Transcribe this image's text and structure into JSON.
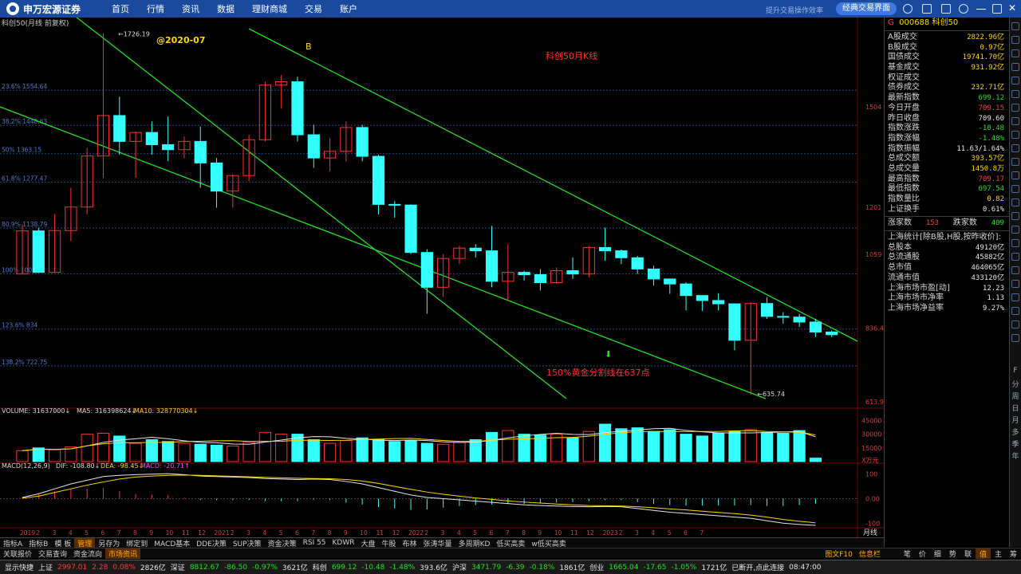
{
  "app": {
    "brand": "申万宏源证券",
    "slogan": "提升交易操作效率"
  },
  "nav": [
    "首页",
    "行情",
    "资讯",
    "数据",
    "理财商城",
    "交易",
    "账户"
  ],
  "classic_button": "经典交易界面",
  "chart": {
    "header": "科创50(月线 前复权)",
    "watermark_date": "@2020-07",
    "label_b": "B",
    "title_note": "科创50月K线",
    "fib_note": "150%黄金分割线在637点",
    "high_label": "1726.19",
    "low_label": "635.74",
    "fib_levels": [
      "23.6% 1554.64",
      "38.2% 1448.63",
      "50% 1363.15",
      "61.8% 1277.47",
      "80.9% 1138.79",
      "100% 1000.11",
      "123.6% 834",
      "138.2% 722.75"
    ],
    "price_axis": [
      "1504",
      "1201",
      "1059",
      "836.4",
      "613.9"
    ],
    "volume_header": {
      "volume": "VOLUME: 31637000↓",
      "ma5": "MA5: 316398624↓",
      "ma10": "MA10: 328770304↓"
    },
    "volume_axis": [
      "45000",
      "30000",
      "15000",
      "X万元"
    ],
    "macd_header": {
      "name": "MACD(12,26,9)",
      "dif": "DIF: -108.80↓",
      "dea": "DEA: -98.45↓",
      "macd": "MACD: -20.71↑"
    },
    "macd_axis": [
      "100",
      "0.00",
      "-100"
    ],
    "date_axis": [
      "2019",
      "2",
      "3",
      "4",
      "5",
      "6",
      "7",
      "8",
      "9",
      "10",
      "11",
      "12",
      "2021",
      "2",
      "3",
      "4",
      "5",
      "6",
      "7",
      "8",
      "9",
      "10",
      "11",
      "12",
      "2022",
      "2",
      "3",
      "4",
      "5",
      "6",
      "7",
      "8",
      "9",
      "10",
      "11",
      "12",
      "2023",
      "2",
      "3",
      "4",
      "5",
      "6",
      "7"
    ],
    "period": "月线"
  },
  "chart_data": {
    "type": "candlestick",
    "candles": [
      [
        1000,
        1130,
        1000,
        1150
      ],
      [
        1130,
        1005,
        1003,
        1140
      ],
      [
        1005,
        1131,
        1005,
        1180
      ],
      [
        1131,
        1202,
        1100,
        1260
      ],
      [
        1202,
        1356,
        1180,
        1380
      ],
      [
        1356,
        1478,
        1290,
        1726.19
      ],
      [
        1478,
        1400,
        1360,
        1535
      ],
      [
        1400,
        1427,
        1290,
        1430
      ],
      [
        1427,
        1390,
        1360,
        1460
      ],
      [
        1390,
        1375,
        1340,
        1475
      ],
      [
        1375,
        1400,
        1350,
        1415
      ],
      [
        1400,
        1335,
        1260,
        1445
      ],
      [
        1335,
        1250,
        1200,
        1350
      ],
      [
        1250,
        1297,
        1200,
        1300
      ],
      [
        1297,
        1405,
        1280,
        1420
      ],
      [
        1405,
        1570,
        1400,
        1580
      ],
      [
        1570,
        1580,
        1500,
        1600
      ],
      [
        1580,
        1420,
        1400,
        1595
      ],
      [
        1420,
        1350,
        1320,
        1450
      ],
      [
        1350,
        1370,
        1310,
        1410
      ],
      [
        1370,
        1442,
        1340,
        1460
      ],
      [
        1442,
        1355,
        1340,
        1450
      ],
      [
        1355,
        1210,
        1180,
        1360
      ],
      [
        1210,
        1208,
        1170,
        1220
      ],
      [
        1208,
        1065,
        1060,
        1210
      ],
      [
        1065,
        960,
        880,
        1075
      ],
      [
        960,
        1047,
        930,
        1060
      ],
      [
        1047,
        1078,
        1030,
        1085
      ],
      [
        1078,
        1070,
        1050,
        1090
      ],
      [
        1070,
        978,
        960,
        1145
      ],
      [
        978,
        1005,
        920,
        1090
      ],
      [
        1005,
        998,
        980,
        1010
      ],
      [
        998,
        974,
        950,
        1015
      ],
      [
        974,
        1010,
        970,
        1020
      ],
      [
        1010,
        1000,
        985,
        1050
      ],
      [
        1000,
        1080,
        990,
        1085
      ],
      [
        1080,
        1070,
        1040,
        1140
      ],
      [
        1070,
        1049,
        1030,
        1074
      ],
      [
        1049,
        1015,
        1000,
        1055
      ],
      [
        1015,
        985,
        965,
        1025
      ],
      [
        985,
        970,
        940,
        985
      ],
      [
        970,
        935,
        890,
        975
      ],
      [
        935,
        920,
        888,
        935
      ],
      [
        920,
        910,
        890,
        942
      ],
      [
        910,
        800,
        770,
        910
      ],
      [
        800,
        911,
        635.74,
        915
      ],
      [
        911,
        872,
        865,
        930
      ],
      [
        872,
        870,
        850,
        885
      ],
      [
        870,
        855,
        840,
        880
      ],
      [
        855,
        825,
        810,
        865
      ],
      [
        825,
        817,
        810,
        830
      ]
    ],
    "volume": [
      12000,
      15000,
      13000,
      16000,
      30000,
      31000,
      28000,
      20000,
      24000,
      22000,
      20000,
      19000,
      18000,
      17000,
      21000,
      32000,
      30000,
      30000,
      24000,
      20000,
      23000,
      26000,
      24000,
      22000,
      23000,
      20000,
      19000,
      21000,
      24000,
      32000,
      34000,
      30000,
      29000,
      30000,
      26000,
      33000,
      41000,
      36000,
      37000,
      33000,
      35000,
      30000,
      28000,
      31000,
      33000,
      35000,
      32000,
      31000,
      34000,
      3800
    ],
    "dif": [
      5,
      20,
      40,
      60,
      75,
      90,
      95,
      98,
      100,
      102,
      98,
      92,
      90,
      88,
      86,
      82,
      80,
      78,
      80,
      78,
      70,
      60,
      45,
      30,
      15,
      5,
      0,
      -5,
      -10,
      -15,
      -20,
      -25,
      -28,
      -30,
      -32,
      -33,
      -32,
      -33,
      -40,
      -48,
      -55,
      -60,
      -65,
      -70,
      -75,
      -80,
      -90,
      -100,
      -105,
      -108.8
    ],
    "dea": [
      2,
      10,
      25,
      40,
      55,
      68,
      80,
      88,
      92,
      95,
      96,
      95,
      93,
      91,
      89,
      87,
      85,
      83,
      82,
      81,
      78,
      72,
      62,
      50,
      38,
      27,
      18,
      10,
      3,
      -3,
      -9,
      -14,
      -18,
      -22,
      -25,
      -28,
      -29,
      -30,
      -33,
      -37,
      -42,
      -46,
      -51,
      -56,
      -61,
      -67,
      -75,
      -85,
      -92,
      -98.45
    ],
    "channel_lines": "three parallel descending lines (upper, middle, lower)",
    "ylim": [
      600,
      1740
    ]
  },
  "right_panel": {
    "code": "000688",
    "name": "科创50",
    "flag": "G",
    "rows": [
      {
        "l": "A股成交",
        "v": "2822.96亿",
        "c": "yel"
      },
      {
        "l": "B股成交",
        "v": "0.97亿",
        "c": "yel"
      },
      {
        "l": "国债成交",
        "v": "19741.70亿",
        "c": "yel"
      },
      {
        "l": "基金成交",
        "v": "931.92亿",
        "c": "yel"
      },
      {
        "l": "权证成交",
        "v": "",
        "c": "yel"
      },
      {
        "l": "债券成交",
        "v": "232.71亿",
        "c": "yel"
      },
      {
        "l": "最新指数",
        "v": "699.12",
        "c": "grn"
      },
      {
        "l": "今日开盘",
        "v": "709.15",
        "c": "red"
      },
      {
        "l": "昨日收盘",
        "v": "709.60",
        "c": "wht"
      },
      {
        "l": "指数涨跌",
        "v": "-10.48",
        "c": "grn"
      },
      {
        "l": "指数涨幅",
        "v": "-1.48%",
        "c": "grn"
      },
      {
        "l": "指数振幅",
        "v": "11.63/1.64%",
        "c": "wht"
      },
      {
        "l": "总成交额",
        "v": "393.57亿",
        "c": "yel"
      },
      {
        "l": "总成交量",
        "v": "1450.8万",
        "c": "yel"
      },
      {
        "l": "最高指数",
        "v": "709.17",
        "c": "red"
      },
      {
        "l": "最低指数",
        "v": "697.54",
        "c": "grn"
      },
      {
        "l": "指数量比",
        "v": "0.82",
        "c": "yel"
      },
      {
        "l": "上证换手",
        "v": "0.61%",
        "c": "wht"
      }
    ],
    "updown": {
      "up_label": "涨家数",
      "up": "153",
      "down_label": "跌家数",
      "down": "409"
    },
    "stats_title": "上海统计[除B股,H股,按昨收价]:",
    "stats": [
      {
        "l": "总股本",
        "v": "49120亿"
      },
      {
        "l": "总流通股",
        "v": "45882亿"
      },
      {
        "l": "总市值",
        "v": "464065亿"
      },
      {
        "l": "流通市值",
        "v": "433120亿"
      },
      {
        "l": "上海市场市盈[动]",
        "v": "12.23"
      },
      {
        "l": "上海市场市净率",
        "v": "1.13"
      },
      {
        "l": "上海市场净益率",
        "v": "9.27%"
      }
    ],
    "strip": [
      "F",
      "分",
      "周",
      "日",
      "月",
      "多",
      "季",
      "年"
    ]
  },
  "tabs": [
    "指标A",
    "指标B",
    "模 板",
    "管理",
    "另存为",
    "绑定到",
    "MACD基本",
    "DDE决策",
    "SUP决策",
    "资金决策",
    "RSI 55",
    "KDWR",
    "大盘",
    "牛股",
    "布林",
    "张涛华量",
    "多周期KD",
    "低买高卖",
    "w低买高卖"
  ],
  "active_tab": "管理",
  "tabs2": [
    "关联报价",
    "交易查询",
    "资金流向",
    "市场资讯"
  ],
  "tabs2_right": [
    "图文F10",
    "信息栏"
  ],
  "bottom_right": [
    "笔",
    "价",
    "细",
    "势",
    "联",
    "值",
    "主",
    "筹"
  ],
  "status": [
    {
      "t": "显示快捷",
      "c": "wht"
    },
    {
      "t": "上证",
      "c": "wht"
    },
    {
      "t": "2997.01",
      "c": "red"
    },
    {
      "t": "2.28",
      "c": "red"
    },
    {
      "t": "0.08%",
      "c": "red"
    },
    {
      "t": "2826亿",
      "c": "wht"
    },
    {
      "t": "深证",
      "c": "wht"
    },
    {
      "t": "8812.67",
      "c": "grn"
    },
    {
      "t": "-86.50",
      "c": "grn"
    },
    {
      "t": "-0.97%",
      "c": "grn"
    },
    {
      "t": "3621亿",
      "c": "wht"
    },
    {
      "t": "科创",
      "c": "wht"
    },
    {
      "t": "699.12",
      "c": "grn"
    },
    {
      "t": "-10.48",
      "c": "grn"
    },
    {
      "t": "-1.48%",
      "c": "grn"
    },
    {
      "t": "393.6亿",
      "c": "wht"
    },
    {
      "t": "沪深",
      "c": "wht"
    },
    {
      "t": "3471.79",
      "c": "grn"
    },
    {
      "t": "-6.39",
      "c": "grn"
    },
    {
      "t": "-0.18%",
      "c": "grn"
    },
    {
      "t": "1861亿",
      "c": "wht"
    },
    {
      "t": "创业",
      "c": "wht"
    },
    {
      "t": "1665.04",
      "c": "grn"
    },
    {
      "t": "-17.65",
      "c": "grn"
    },
    {
      "t": "-1.05%",
      "c": "grn"
    },
    {
      "t": "1721亿",
      "c": "wht"
    },
    {
      "t": "已断开,点此连接",
      "c": "wht"
    },
    {
      "t": "08:47:00",
      "c": "wht"
    }
  ]
}
